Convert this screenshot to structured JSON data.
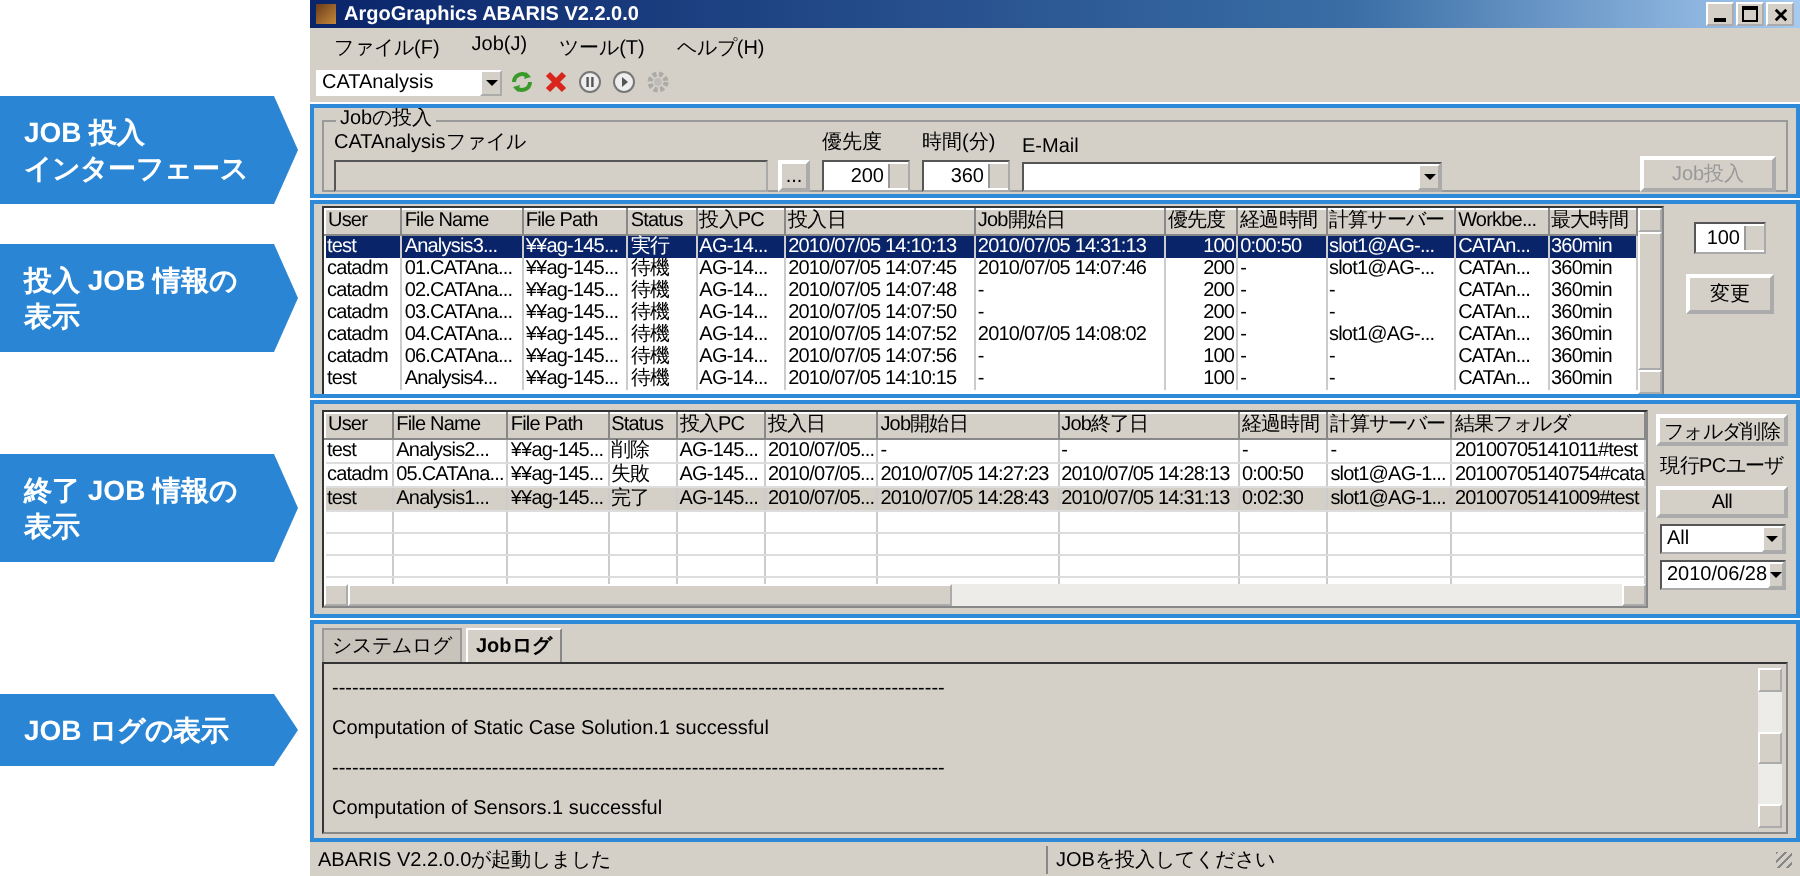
{
  "annotations": [
    {
      "lines": [
        "JOB 投入",
        "インターフェース"
      ]
    },
    {
      "lines": [
        "投入 JOB 情報の",
        "表示"
      ]
    },
    {
      "lines": [
        "終了 JOB 情報の",
        "表示"
      ]
    },
    {
      "lines": [
        "JOB ログの表示"
      ]
    }
  ],
  "window": {
    "title": "ArgoGraphics ABARIS V2.2.0.0",
    "menu": [
      "ファイル(F)",
      "Job(J)",
      "ツール(T)",
      "ヘルプ(H)"
    ],
    "toolbar": {
      "combo": "CATAnalysis",
      "buttons": [
        {
          "kind": "refresh",
          "disabled": false
        },
        {
          "kind": "delete",
          "disabled": false
        },
        {
          "kind": "pause",
          "disabled": false
        },
        {
          "kind": "play",
          "disabled": false
        },
        {
          "kind": "settings",
          "disabled": true
        }
      ]
    }
  },
  "submit": {
    "legend": "Jobの投入",
    "file_label": "CATAnalysisファイル",
    "browse": "...",
    "priority_label": "優先度",
    "priority": "200",
    "time_label": "時間(分)",
    "time": "360",
    "email_label": "E-Mail",
    "button": {
      "label": "Job投入",
      "disabled": true
    }
  },
  "running": {
    "columns": [
      "User",
      "File Name",
      "File Path",
      "Status",
      "投入PC",
      "投入日",
      "Job開始日",
      "優先度",
      "経過時間",
      "計算サーバー",
      "Workbe...",
      "最大時間"
    ],
    "rows": [
      {
        "selected": true,
        "cells": [
          "test",
          "Analysis3...",
          "¥¥ag-145...",
          "実行",
          "AG-14...",
          "2010/07/05 14:10:13",
          "2010/07/05 14:31:13",
          "100",
          "0:00:50",
          "slot1@AG-...",
          "CATAn...",
          "360min"
        ]
      },
      {
        "selected": false,
        "cells": [
          "catadm",
          "01.CATAna...",
          "¥¥ag-145...",
          "待機",
          "AG-14...",
          "2010/07/05 14:07:45",
          "2010/07/05 14:07:46",
          "200",
          "-",
          "slot1@AG-...",
          "CATAn...",
          "360min"
        ]
      },
      {
        "selected": false,
        "cells": [
          "catadm",
          "02.CATAna...",
          "¥¥ag-145...",
          "待機",
          "AG-14...",
          "2010/07/05 14:07:48",
          "-",
          "200",
          "-",
          "-",
          "CATAn...",
          "360min"
        ]
      },
      {
        "selected": false,
        "cells": [
          "catadm",
          "03.CATAna...",
          "¥¥ag-145...",
          "待機",
          "AG-14...",
          "2010/07/05 14:07:50",
          "-",
          "200",
          "-",
          "-",
          "CATAn...",
          "360min"
        ]
      },
      {
        "selected": false,
        "cells": [
          "catadm",
          "04.CATAna...",
          "¥¥ag-145...",
          "待機",
          "AG-14...",
          "2010/07/05 14:07:52",
          "2010/07/05 14:08:02",
          "200",
          "-",
          "slot1@AG-...",
          "CATAn...",
          "360min"
        ]
      },
      {
        "selected": false,
        "cells": [
          "catadm",
          "06.CATAna...",
          "¥¥ag-145...",
          "待機",
          "AG-14...",
          "2010/07/05 14:07:56",
          "-",
          "100",
          "-",
          "-",
          "CATAn...",
          "360min"
        ]
      },
      {
        "selected": false,
        "cells": [
          "test",
          "Analysis4...",
          "¥¥ag-145...",
          "待機",
          "AG-14...",
          "2010/07/05 14:10:15",
          "-",
          "100",
          "-",
          "-",
          "CATAn...",
          "360min"
        ]
      }
    ],
    "priority": "100",
    "change_button": "変更"
  },
  "finished": {
    "columns": [
      "User",
      "File Name",
      "File Path",
      "Status",
      "投入PC",
      "投入日",
      "Job開始日",
      "Job終了日",
      "経過時間",
      "計算サーバー",
      "結果フォルダ"
    ],
    "rows": [
      {
        "selected": false,
        "cells": [
          "test",
          "Analysis2...",
          "¥¥ag-145...",
          "削除",
          "AG-145...",
          "2010/07/05...",
          "-",
          "-",
          "-",
          "-",
          "20100705141011#test"
        ]
      },
      {
        "selected": false,
        "cells": [
          "catadm",
          "05.CATAna...",
          "¥¥ag-145...",
          "失敗",
          "AG-145...",
          "2010/07/05...",
          "2010/07/05 14:27:23",
          "2010/07/05 14:28:13",
          "0:00:50",
          "slot1@AG-1...",
          "20100705140754#cata"
        ]
      },
      {
        "selected": true,
        "cells": [
          "test",
          "Analysis1...",
          "¥¥ag-145...",
          "完了",
          "AG-145...",
          "2010/07/05...",
          "2010/07/05 14:28:43",
          "2010/07/05 14:31:13",
          "0:02:30",
          "slot1@AG-1...",
          "20100705141009#test"
        ]
      }
    ],
    "folder_delete": "フォルダ削除",
    "user_label": "現行PCユーザ",
    "all_button": "All",
    "filter": "All",
    "date": "2010/06/28"
  },
  "log": {
    "tabs": [
      {
        "label": "システムログ",
        "selected": false
      },
      {
        "label": "Jobログ",
        "selected": true
      }
    ],
    "lines": [
      "--------------------------------------------------------------------------------------------",
      "Computation of Static Case Solution.1 successful",
      "--------------------------------------------------------------------------------------------",
      "Computation of Sensors.1 successful"
    ]
  },
  "status_bar": [
    "ABARIS V2.2.0.0が起動しました",
    "JOBを投入してください"
  ]
}
